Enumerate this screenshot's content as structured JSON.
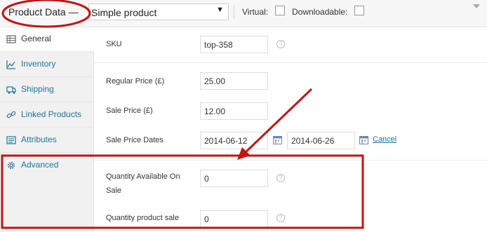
{
  "header": {
    "title": "Product Data —",
    "product_type": "Simple product",
    "virtual_label": "Virtual:",
    "downloadable_label": "Downloadable:"
  },
  "tabs": [
    {
      "label": "General",
      "icon": "grid-icon",
      "active": true
    },
    {
      "label": "Inventory",
      "icon": "chart-icon"
    },
    {
      "label": "Shipping",
      "icon": "truck-icon"
    },
    {
      "label": "Linked Products",
      "icon": "link-icon"
    },
    {
      "label": "Attributes",
      "icon": "list-icon"
    },
    {
      "label": "Advanced",
      "icon": "gear-icon"
    }
  ],
  "fields": {
    "sku": {
      "label": "SKU",
      "value": "top-358"
    },
    "regular_price": {
      "label": "Regular Price (£)",
      "value": "25.00"
    },
    "sale_price": {
      "label": "Sale Price (£)",
      "value": "12.00"
    },
    "sale_dates": {
      "label": "Sale Price Dates",
      "from": "2014-06-12",
      "to": "2014-06-26",
      "cancel": "Cancel"
    },
    "qty_available": {
      "label_line1": "Quantity Available On",
      "label_line2": "Sale",
      "value": "0"
    },
    "qty_product_sale": {
      "label": "Quantity product sale",
      "value": "0"
    }
  },
  "colors": {
    "annotation": "#c01515",
    "link": "#21759b"
  }
}
